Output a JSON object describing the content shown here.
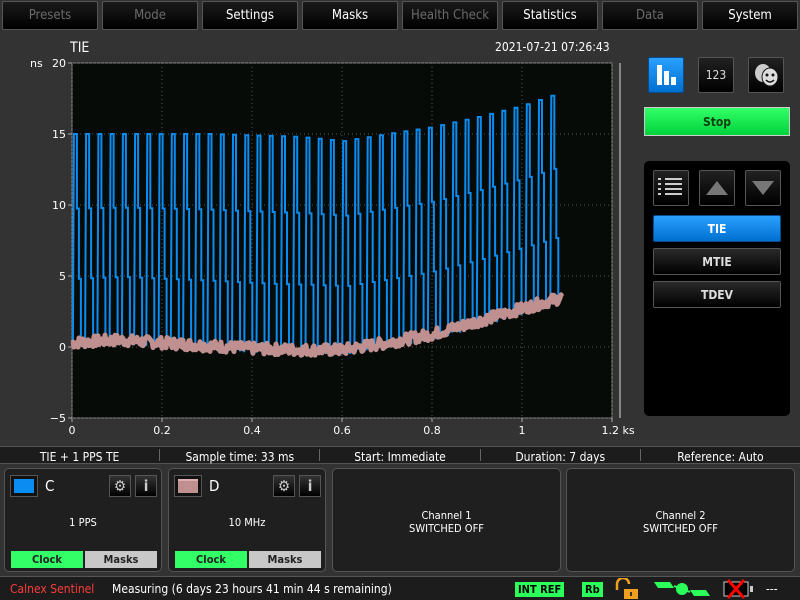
{
  "tabs": [
    {
      "label": "Presets",
      "enabled": false
    },
    {
      "label": "Mode",
      "enabled": false
    },
    {
      "label": "Settings",
      "enabled": true
    },
    {
      "label": "Masks",
      "enabled": true
    },
    {
      "label": "Health Check",
      "enabled": false
    },
    {
      "label": "Statistics",
      "enabled": true
    },
    {
      "label": "Data",
      "enabled": false
    },
    {
      "label": "System",
      "enabled": true
    }
  ],
  "graph": {
    "title": "TIE",
    "timestamp": "2021-07-21 07:26:43"
  },
  "view_buttons": {
    "chart_icon": "bar-chart-icon",
    "numeric_label": "123",
    "masks_icon": "theater-masks-icon"
  },
  "stop_label": "Stop",
  "measurements": {
    "items": [
      "TIE",
      "MTIE",
      "TDEV"
    ],
    "selected": "TIE"
  },
  "info_bar": [
    "TIE + 1 PPS TE",
    "Sample time: 33 ms",
    "Start: Immediate",
    "Duration: 7 days",
    "Reference: Auto"
  ],
  "channels": [
    {
      "name": "C",
      "color": "#0a8cf0",
      "signal": "1 PPS",
      "clock_label": "Clock",
      "masks_label": "Masks"
    },
    {
      "name": "D",
      "color": "#c09090",
      "signal": "10 MHz",
      "clock_label": "Clock",
      "masks_label": "Masks"
    }
  ],
  "off_channels": [
    {
      "name": "Channel 1",
      "state": "SWITCHED OFF"
    },
    {
      "name": "Channel 2",
      "state": "SWITCHED OFF"
    }
  ],
  "status": {
    "brand": "Calnex Sentinel",
    "message": "Measuring (6 days 23 hours 41 min 44 s remaining)",
    "int_ref": "INT REF",
    "rb": "Rb",
    "battery_text": "---"
  },
  "chart_data": {
    "type": "line",
    "title": "TIE",
    "ylabel": "ns",
    "xlabel": "",
    "x_unit": "ks",
    "xlim": [
      0,
      1.2
    ],
    "ylim": [
      -5,
      20
    ],
    "x_ticks": [
      "0",
      "0.2",
      "0.4",
      "0.6",
      "0.8",
      "1",
      "1.2 ks"
    ],
    "x_tick_values": [
      0,
      0.2,
      0.4,
      0.6,
      0.8,
      1,
      1.2
    ],
    "y_ticks": [
      "20",
      "15",
      "10",
      "5",
      "0",
      "−5"
    ],
    "y_tick_values": [
      20,
      15,
      10,
      5,
      0,
      -5
    ],
    "grid": true,
    "series": [
      {
        "color": "#0a8cf0",
        "description": "periodic pulses",
        "pulse_period_ks": 0.0272,
        "x_end": 1.09,
        "peak": {
          "x": [
            0,
            0.3,
            0.5,
            0.6,
            0.7,
            0.8,
            0.9,
            1.0,
            1.09
          ],
          "y": [
            15,
            15,
            14.8,
            14.5,
            15,
            15.5,
            16.2,
            17,
            18
          ]
        }
      },
      {
        "color": "#c09090",
        "baseline": {
          "x": [
            0,
            0.1,
            0.2,
            0.3,
            0.4,
            0.5,
            0.6,
            0.7,
            0.8,
            0.9,
            1.0,
            1.09
          ],
          "y": [
            0.3,
            0.5,
            0.3,
            0.1,
            -0.1,
            -0.2,
            -0.2,
            0.3,
            0.9,
            1.8,
            2.7,
            3.5
          ]
        }
      }
    ]
  }
}
